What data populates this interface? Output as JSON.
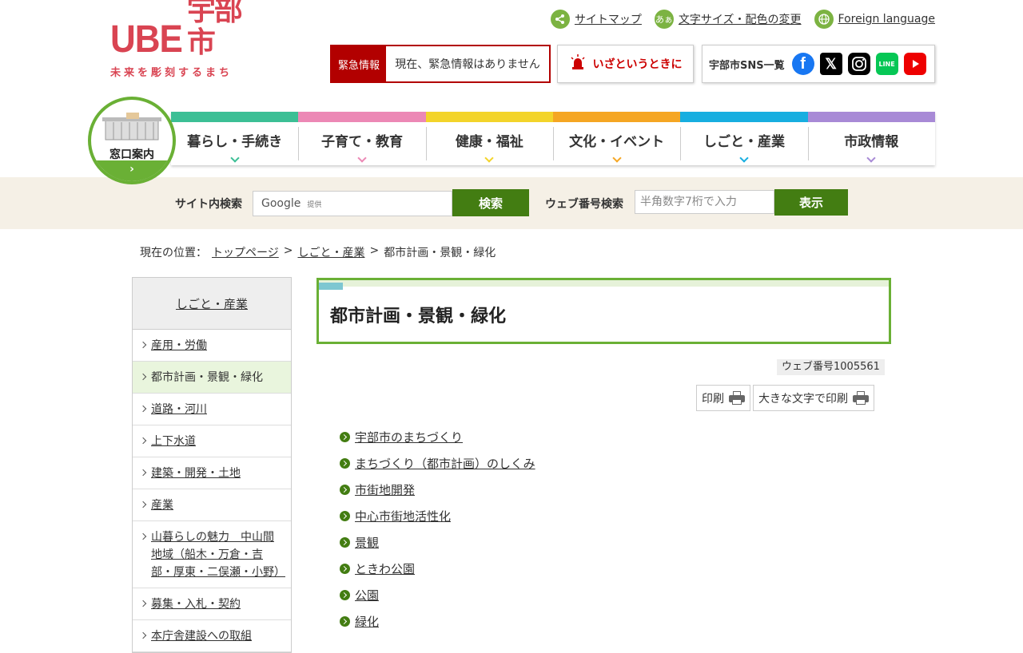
{
  "logo": {
    "ube": "UBE",
    "kanji": "宇部市",
    "tagline": "未来を彫刻するまち"
  },
  "toplinks": [
    {
      "label": "サイトマップ",
      "icon": "share-icon"
    },
    {
      "label": "文字サイズ・配色の変更",
      "icon": "text-size-icon",
      "icon_text": "あぁ"
    },
    {
      "label": "Foreign language",
      "icon": "globe-icon"
    }
  ],
  "emergency": {
    "label": "緊急情報",
    "text": "現在、緊急情報はありません"
  },
  "iza": {
    "label": "いざというときに"
  },
  "sns": {
    "label": "宇部市SNS一覧",
    "items": [
      "facebook",
      "x",
      "instagram",
      "line",
      "youtube"
    ],
    "line_text": "LINE"
  },
  "madoguchi": {
    "label": "窓口案内",
    "arrow": "›"
  },
  "gnav": [
    {
      "label": "暮らし・手続き",
      "color": "#3cbf95"
    },
    {
      "label": "子育て・教育",
      "color": "#ec88b5"
    },
    {
      "label": "健康・福祉",
      "color": "#f3d42a"
    },
    {
      "label": "文化・イベント",
      "color": "#f5a623"
    },
    {
      "label": "しごと・産業",
      "color": "#17aee0"
    },
    {
      "label": "市政情報",
      "color": "#a88ad6"
    }
  ],
  "search": {
    "site_label": "サイト内検索",
    "google": "Google",
    "provided": "提供",
    "search_button": "検索",
    "webno_label": "ウェブ番号検索",
    "webno_placeholder": "半角数字7桁で入力",
    "show_button": "表示"
  },
  "breadcrumb": {
    "prefix": "現在の位置：",
    "items": [
      "トップページ",
      "しごと・産業"
    ],
    "sep": ">",
    "current": "都市計画・景観・緑化"
  },
  "side": {
    "head": "しごと・産業",
    "items": [
      "産用・労働",
      "都市計画・景観・緑化",
      "道路・河川",
      "上下水道",
      "建築・開発・土地",
      "産業",
      "山暮らしの魅力　中山間地域（船木・万倉・吉部・厚東・二俣瀬・小野）",
      "募集・入札・契約",
      "本庁舎建設への取組"
    ]
  },
  "main": {
    "title": "都市計画・景観・緑化",
    "webnum": "ウェブ番号1005561",
    "print": "印刷",
    "print_large": "大きな文字で印刷",
    "links": [
      "宇部市のまちづくり",
      "まちづくり（都市計画）のしくみ",
      "市街地開発",
      "中心市街地活性化",
      "景観",
      "ときわ公園",
      "公園",
      "緑化"
    ]
  },
  "colors": {
    "brand_red": "#d94452",
    "green": "#6ab035",
    "dark_green": "#437d12",
    "emergency_red": "#b20000"
  }
}
